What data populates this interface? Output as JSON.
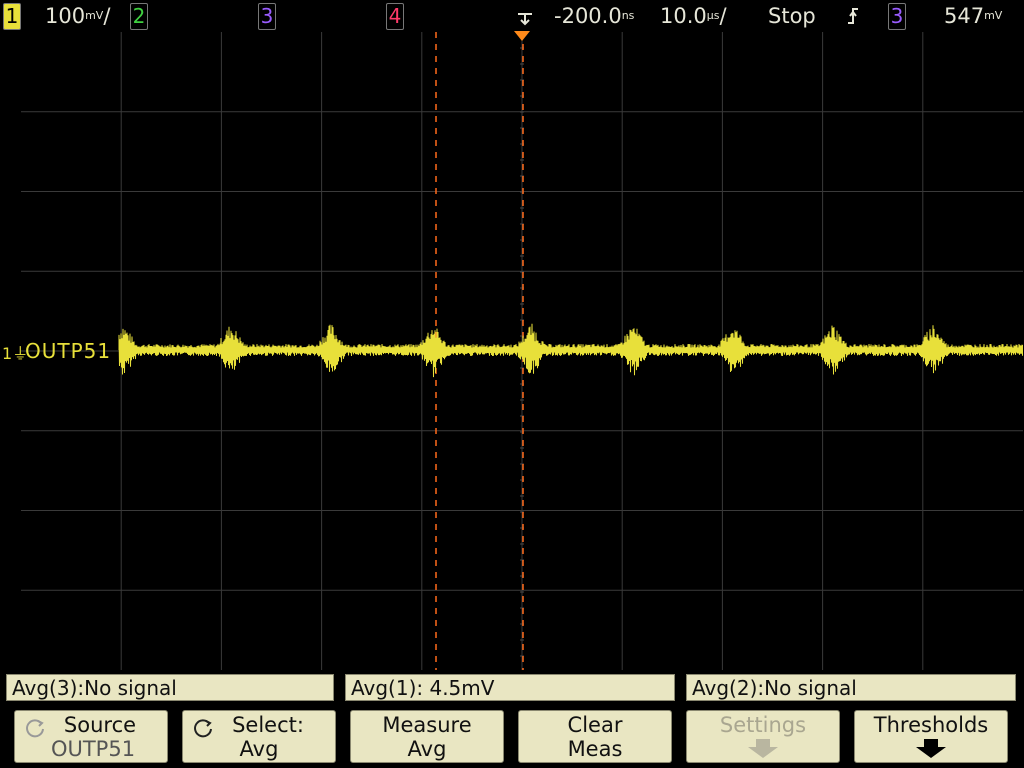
{
  "topbar": {
    "ch1_num": "1",
    "ch1_scale": "100",
    "ch1_scale_unit": "mV",
    "ch2_num": "2",
    "ch3_num": "3",
    "ch4_num": "4",
    "delay": "-200.0",
    "delay_unit": "ns",
    "timebase": "10.0",
    "timebase_unit": "µs",
    "run_state": "Stop",
    "trigger_slope_icon": "rising-edge-icon",
    "trigger_source": "3",
    "trigger_level": "547",
    "trigger_level_unit": "mV"
  },
  "trace": {
    "channel_marker": "1",
    "label": "OUTP51",
    "color": "#e8e03a"
  },
  "measurements": [
    {
      "text": "Avg(3):No signal"
    },
    {
      "text": "Avg(1): 4.5mV"
    },
    {
      "text": "Avg(2):No signal"
    }
  ],
  "softkeys": [
    {
      "line1": "Source",
      "line2": "OUTP51",
      "icon": "rotary-knob-icon",
      "enabled": true
    },
    {
      "line1": "Select:",
      "line2": "Avg",
      "icon": "rotary-knob-icon",
      "enabled": true
    },
    {
      "line1": "Measure",
      "line2": "Avg",
      "enabled": true
    },
    {
      "line1": "Clear",
      "line2": "Meas",
      "enabled": true
    },
    {
      "line1": "Settings",
      "icon": "down-arrow-icon",
      "enabled": false
    },
    {
      "line1": "Thresholds",
      "icon": "down-arrow-icon",
      "enabled": true
    }
  ],
  "colors": {
    "ch1": "#e8e03a",
    "ch2": "#3fd040",
    "ch3": "#9a5cff",
    "ch4": "#ff3a6a",
    "softkey_bg": "#e9e6c2",
    "cursor": "#ff6a1a"
  }
}
